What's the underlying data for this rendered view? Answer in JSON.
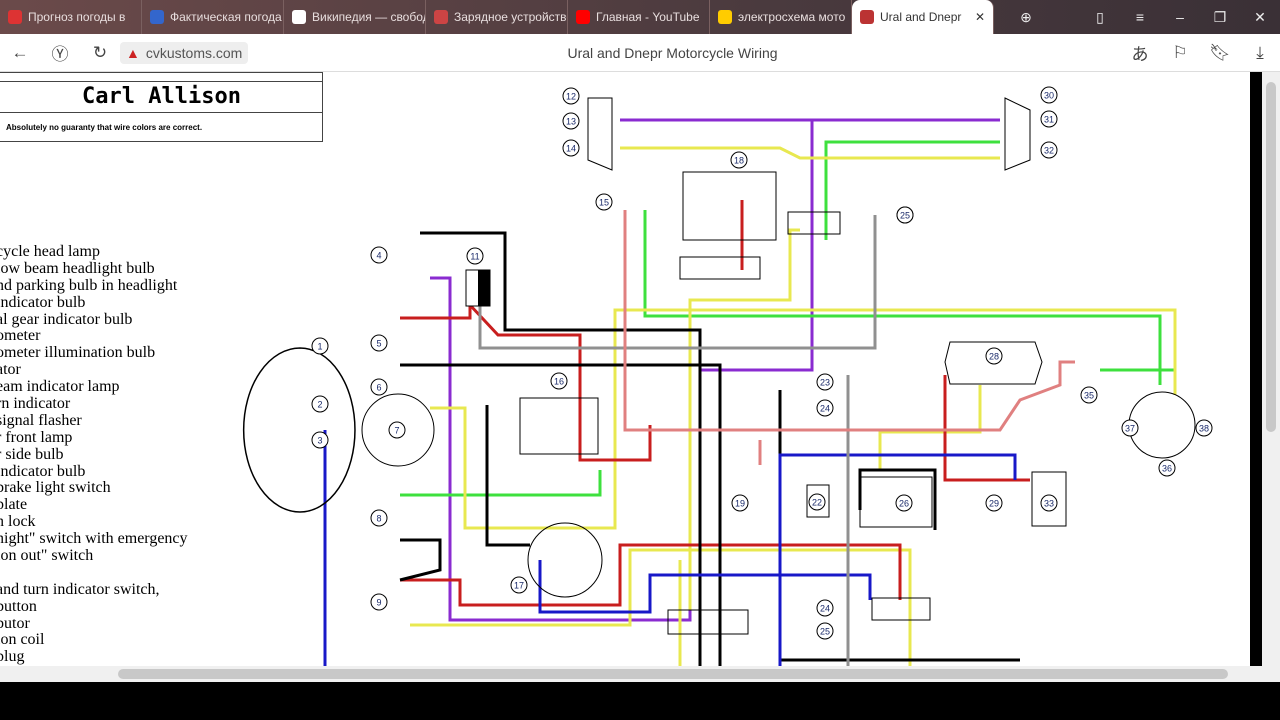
{
  "tabs": [
    {
      "label": "Прогноз погоды в",
      "color": "#d33"
    },
    {
      "label": "Фактическая погода",
      "color": "#36c"
    },
    {
      "label": "Википедия — свободная",
      "color": "#fff"
    },
    {
      "label": "Зарядное устройство",
      "color": "#c44"
    },
    {
      "label": "Главная - YouTube",
      "color": "#f00"
    },
    {
      "label": "электросхема мото",
      "color": "#fc0"
    },
    {
      "label": "Ural and Dnepr",
      "color": "#b33",
      "active": true
    }
  ],
  "url": "cvkustoms.com",
  "page_title": "Ural and Dnepr Motorcycle Wiring",
  "doc": {
    "author": "Carl Allison",
    "disclaimer": "Absolutely no guaranty that wire colors are correct.",
    "legend": [
      "cycle head lamp",
      "low  beam headlight bulb",
      "nd parking bulb in headlight",
      "indicator bulb",
      "al gear indicator bulb",
      "ometer",
      "ometer illumination bulb",
      "ator",
      "eam indicator lamp",
      "rn indicator",
      "signal flasher",
      "r front lamp",
      "r side bulb",
      "indicator bulb",
      "brake light switch",
      "plate",
      "n lock",
      "night\" switch with emergency",
      "ion out\" switch",
      "",
      "and turn indicator switch,",
      "button",
      "butor",
      "ion coil",
      "plug"
    ]
  },
  "diagram": {
    "labels": [
      "1",
      "2",
      "3",
      "4",
      "5",
      "6",
      "7",
      "8",
      "9",
      "11",
      "12",
      "13",
      "14",
      "15",
      "16",
      "17",
      "18",
      "19",
      "22",
      "23",
      "24",
      "25",
      "24",
      "25",
      "26",
      "28",
      "29",
      "30",
      "31",
      "32",
      "33",
      "35",
      "36",
      "37",
      "38",
      "25"
    ],
    "wire_colors": {
      "purple": "#8a2bd0",
      "green": "#3ee03e",
      "yellow": "#e8e850",
      "red": "#c81e1e",
      "black": "#000000",
      "blue": "#1818c8",
      "gray": "#909090",
      "pink": "#e08080"
    }
  }
}
